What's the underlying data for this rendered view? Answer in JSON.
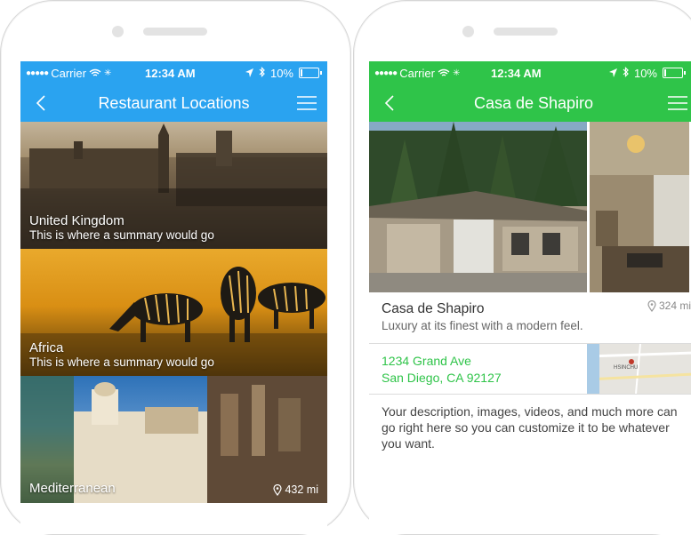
{
  "status": {
    "carrier": "Carrier",
    "time": "12:34 AM",
    "battery": "10%",
    "battery_level": 0.1
  },
  "left": {
    "title": "Restaurant Locations",
    "nav_color": "#2aa3f0",
    "locations": [
      {
        "name": "United Kingdom",
        "summary": "This is where a summary would go"
      },
      {
        "name": "Africa",
        "summary": "This is where a summary would go"
      },
      {
        "name": "Mediterranean",
        "distance": "432 mi"
      }
    ]
  },
  "right": {
    "title": "Casa de Shapiro",
    "nav_color": "#2fc449",
    "detail_title": "Casa de Shapiro",
    "detail_subtitle": "Luxury at its finest with a modern feel.",
    "distance": "324 mi",
    "address_line1": "1234 Grand Ave",
    "address_line2": "San Diego, CA 92127",
    "map_label": "HSINCHU",
    "description": "Your description, images, videos, and much more can go right here so you can customize it to be whatever you want."
  },
  "icons": {
    "back": "chevron-left-icon",
    "menu": "hamburger-menu-icon",
    "location": "location-pin-icon",
    "wifi": "wifi-icon",
    "navigation": "location-arrow-icon",
    "bluetooth": "bluetooth-icon"
  }
}
